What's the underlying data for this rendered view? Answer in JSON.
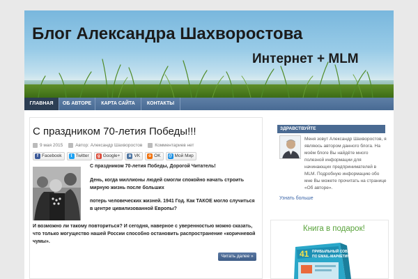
{
  "header": {
    "title": "Блог Александра Шахворостова",
    "tagline": "Интернет + MLM"
  },
  "nav": {
    "items": [
      {
        "label": "ГЛАВНАЯ",
        "active": true
      },
      {
        "label": "ОБ АВТОРЕ",
        "active": false
      },
      {
        "label": "КАРТА САЙТА",
        "active": false
      },
      {
        "label": "КОНТАКТЫ",
        "active": false
      }
    ]
  },
  "post": {
    "title": "С праздником 70-летия Победы!!!",
    "date": "9 мая 2015",
    "author": "Автор: Александр Шахворостов",
    "comments": "Комментариев нет",
    "share": [
      {
        "label": "Facebook",
        "icon": "facebook-icon",
        "color": "#3b5998",
        "glyph": "f"
      },
      {
        "label": "Twitter",
        "icon": "twitter-icon",
        "color": "#1da1f2",
        "glyph": "t"
      },
      {
        "label": "Google+",
        "icon": "google-plus-icon",
        "color": "#dd4b39",
        "glyph": "g"
      },
      {
        "label": "VK",
        "icon": "vk-icon",
        "color": "#4c75a3",
        "glyph": "в"
      },
      {
        "label": "OK",
        "icon": "ok-icon",
        "color": "#f2720c",
        "glyph": "o"
      },
      {
        "label": "Мой Мир",
        "icon": "moy-mir-icon",
        "color": "#168de2",
        "glyph": "@"
      }
    ],
    "p1": "С праздником 70-летия Победы, Дорогой Читатель!",
    "p2": "День, когда миллионы людей смогли спокойно начать строить мирную жизнь после больших",
    "p3": "потерь человеческих жизней. 1941 Год. Как ТАКОЕ могло случиться в  центре цивилизованной Европы?",
    "p4": "И возможно ли такому повториться? И сегодня, наверное с уверенностью можно сказать, что  только могущество нашей России способно остановить распространение «коричневой чумы».",
    "read_more": "Читать далее »"
  },
  "sidebar": {
    "widget_title": "ЗДРАВСТВУЙТЕ",
    "about": "Меня зовут Александр Шахворостов, я являюсь автором данного блога. На моём блоге Вы найдёте много полезной информации для начинающих предпринимателей в MLM. Подробную информацию обо мне Вы можете прочитать на странице «Об авторе».",
    "more_link": "Узнать больше",
    "gift_title": "Книга в подарок!",
    "book_number": "41",
    "book_line1": "ПРИБЫЛЬНЫЙ СОВЕТ",
    "book_line2": "ПО EMAIL-МАРКЕТИНГУ"
  },
  "colors": {
    "nav": "#4f7099",
    "nav_active": "#2c3e54",
    "link": "#3c66a8",
    "gift": "#58a23a"
  }
}
